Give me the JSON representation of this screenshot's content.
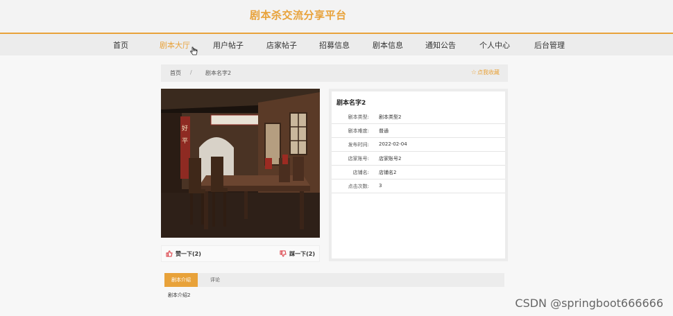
{
  "site_title": "剧本杀交流分享平台",
  "nav": [
    "首页",
    "剧本大厅",
    "用户帖子",
    "店家帖子",
    "招募信息",
    "剧本信息",
    "通知公告",
    "个人中心",
    "后台管理"
  ],
  "nav_active": "剧本大厅",
  "breadcrumb": {
    "home": "首页",
    "separator": "/",
    "current": "剧本名字2"
  },
  "favorite_label": "点我收藏",
  "votes": {
    "up": "赞一下(2)",
    "down": "踩一下(2)"
  },
  "info": {
    "title": "剧本名字2",
    "rows": [
      {
        "label": "剧本类型:",
        "value": "剧本类型2"
      },
      {
        "label": "剧本难度:",
        "value": "普通"
      },
      {
        "label": "发布时间:",
        "value": "2022-02-04"
      },
      {
        "label": "店家账号:",
        "value": "店家账号2"
      },
      {
        "label": "店铺名:",
        "value": "店铺名2"
      },
      {
        "label": "点击次数:",
        "value": "3"
      }
    ]
  },
  "tabs": [
    "剧本介绍",
    "评论"
  ],
  "tab_content": "剧本介绍2",
  "watermark": "CSDN @springboot666666",
  "colors": {
    "accent": "#e8a23a",
    "vote_icon": "#d9363e"
  }
}
